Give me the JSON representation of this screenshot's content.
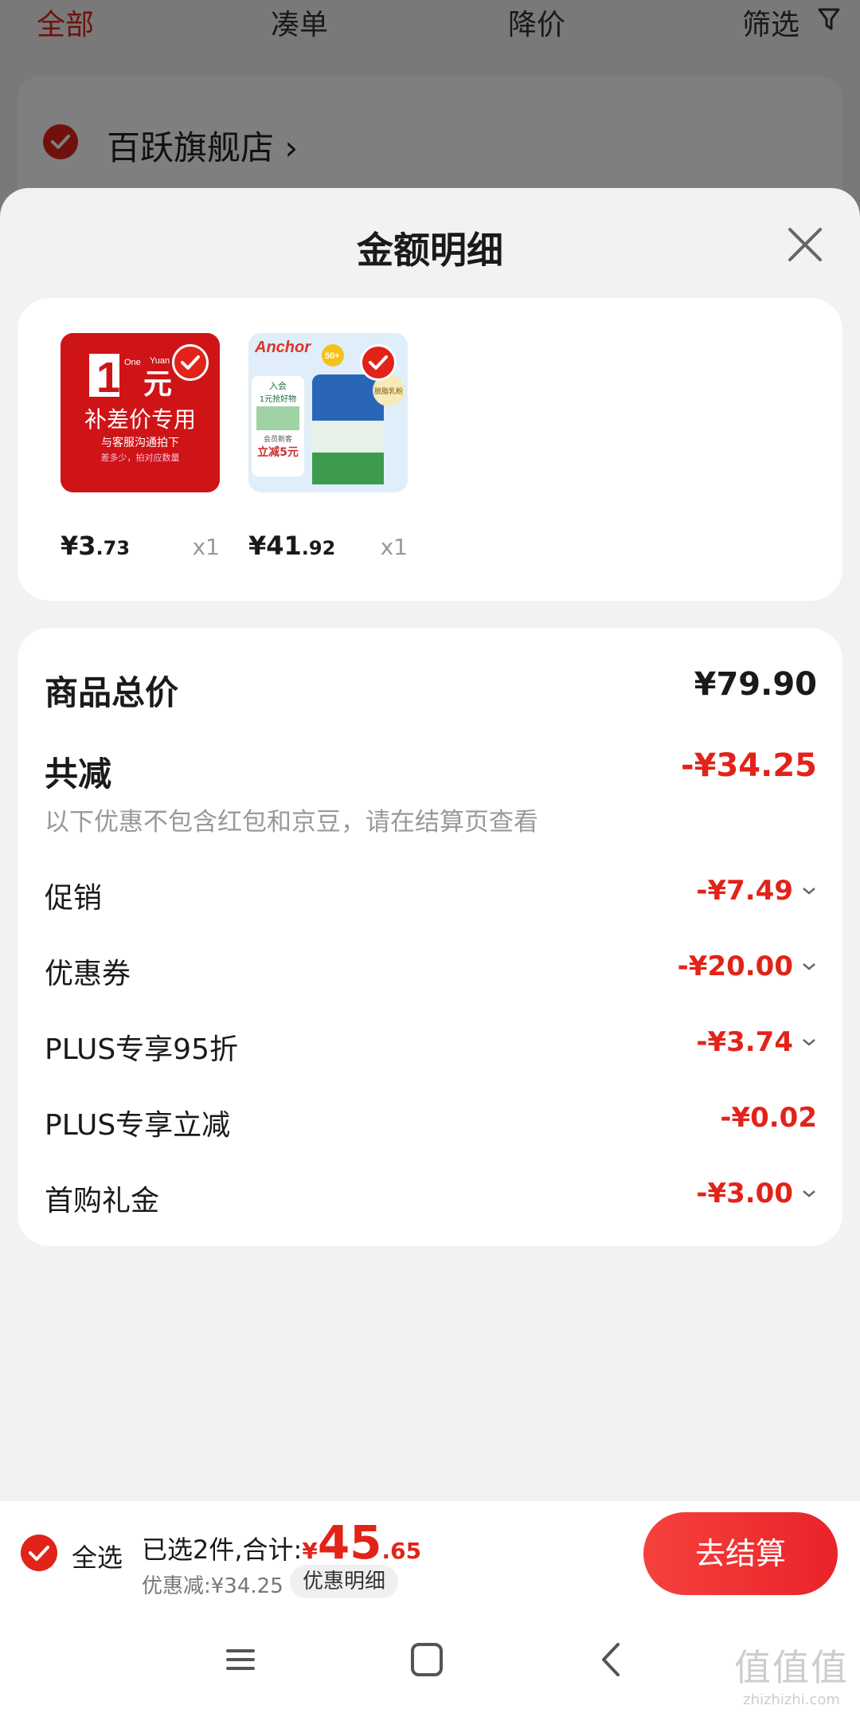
{
  "background": {
    "tabs": [
      "全部",
      "凑单",
      "降价",
      "筛选"
    ],
    "store_name": "百跃旗舰店 ›"
  },
  "sheet": {
    "title": "金额明细",
    "products": [
      {
        "price_symbol": "¥",
        "price_int": "3",
        "price_dec": ".73",
        "qty": "x1",
        "image_text": [
          "1",
          "One",
          "Yuan",
          "元",
          "补差价专用",
          "与客服沟通拍下",
          "差多少，拍对应数量"
        ]
      },
      {
        "price_symbol": "¥",
        "price_int": "41",
        "price_dec": ".92",
        "qty": "x1",
        "image_text": [
          "Anchor",
          "50+",
          "入会",
          "1元抢好物",
          "会员新客",
          "立减5元",
          "脱脂乳粉"
        ]
      }
    ],
    "details": {
      "goods_total_label": "商品总价",
      "goods_total_value": "¥79.90",
      "reduce_label": "共减",
      "reduce_value": "-¥34.25",
      "note": "以下优惠不包含红包和京豆，请在结算页查看",
      "items": [
        {
          "label": "促销",
          "value": "-¥7.49",
          "expandable": true
        },
        {
          "label": "优惠券",
          "value": "-¥20.00",
          "expandable": true
        },
        {
          "label": "PLUS专享95折",
          "value": "-¥3.74",
          "expandable": true
        },
        {
          "label": "PLUS专享立减",
          "value": "-¥0.02",
          "expandable": false
        },
        {
          "label": "首购礼金",
          "value": "-¥3.00",
          "expandable": true
        }
      ]
    }
  },
  "bottom_bar": {
    "select_all": "全选",
    "summary_prefix": "已选2件,合计:",
    "total_symbol": "¥",
    "total_int": "45",
    "total_dec": ".65",
    "discount_line": "优惠减:¥34.25",
    "detail_pill": "优惠明细",
    "checkout": "去结算"
  },
  "watermark": {
    "line1": "值值值",
    "line2": "zhizhizhi.com"
  },
  "colors": {
    "accent": "#e2231a",
    "overlay": "rgba(0,0,0,0.5)"
  }
}
